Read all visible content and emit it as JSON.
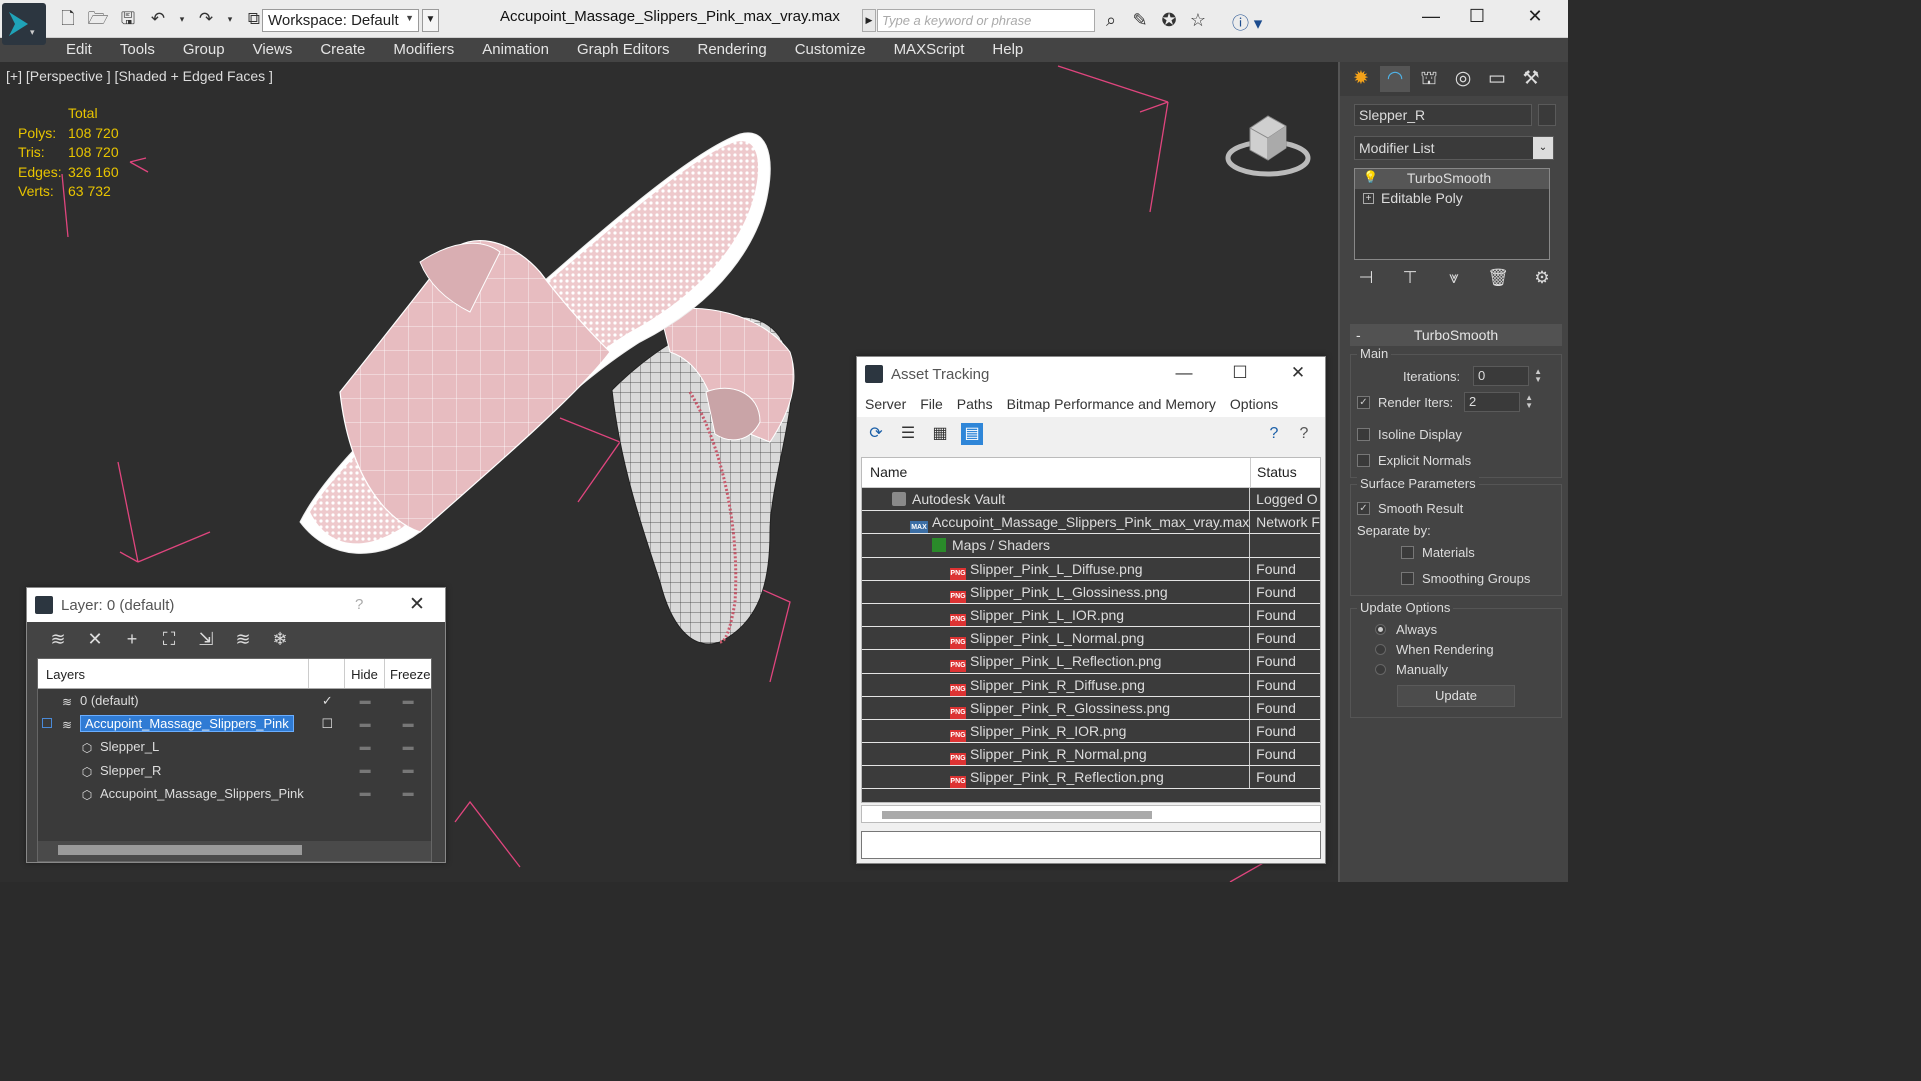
{
  "titlebar": {
    "workspace": "Workspace: Default",
    "document": "Accupoint_Massage_Slippers_Pink_max_vray.max",
    "search_placeholder": "Type a keyword or phrase"
  },
  "menu": [
    "Edit",
    "Tools",
    "Group",
    "Views",
    "Create",
    "Modifiers",
    "Animation",
    "Graph Editors",
    "Rendering",
    "Customize",
    "MAXScript",
    "Help"
  ],
  "viewport": {
    "label": "[+] [Perspective ] [Shaded + Edged Faces ]",
    "stats_header": "Total",
    "stats": [
      {
        "k": "Polys:",
        "v": "108 720"
      },
      {
        "k": "Tris:",
        "v": "108 720"
      },
      {
        "k": "Edges:",
        "v": "326 160"
      },
      {
        "k": "Verts:",
        "v": "63 732"
      }
    ],
    "colors": {
      "slipper": "#e8c3c6",
      "grid": "#e0457e",
      "stats": "#e8c400"
    }
  },
  "command_panel": {
    "object_name": "Slepper_R",
    "modifier_list": "Modifier List",
    "stack": [
      "TurboSmooth",
      "Editable Poly"
    ],
    "rollout_title": "TurboSmooth",
    "main_label": "Main",
    "iterations_label": "Iterations:",
    "iterations_value": "0",
    "render_iters_label": "Render Iters:",
    "render_iters_value": "2",
    "isoline": "Isoline Display",
    "explicit_normals": "Explicit Normals",
    "surface_params": "Surface Parameters",
    "smooth_result": "Smooth Result",
    "separate_by": "Separate by:",
    "materials": "Materials",
    "smoothing_groups": "Smoothing Groups",
    "update_options": "Update Options",
    "always": "Always",
    "when_rendering": "When Rendering",
    "manually": "Manually",
    "update_button": "Update"
  },
  "asset_tracking": {
    "title": "Asset Tracking",
    "menu": [
      "Server",
      "File",
      "Paths",
      "Bitmap Performance and Memory",
      "Options"
    ],
    "col_name": "Name",
    "col_status": "Status",
    "rows": [
      {
        "name": "Autodesk Vault",
        "status": "Logged O",
        "indent": 30,
        "icon": "vault"
      },
      {
        "name": "Accupoint_Massage_Slippers_Pink_max_vray.max",
        "status": "Network F",
        "indent": 48,
        "icon": "max"
      },
      {
        "name": "Maps / Shaders",
        "status": "",
        "indent": 70,
        "icon": "maps"
      },
      {
        "name": "Slipper_Pink_L_Diffuse.png",
        "status": "Found",
        "indent": 88,
        "icon": "png"
      },
      {
        "name": "Slipper_Pink_L_Glossiness.png",
        "status": "Found",
        "indent": 88,
        "icon": "png"
      },
      {
        "name": "Slipper_Pink_L_IOR.png",
        "status": "Found",
        "indent": 88,
        "icon": "png"
      },
      {
        "name": "Slipper_Pink_L_Normal.png",
        "status": "Found",
        "indent": 88,
        "icon": "png"
      },
      {
        "name": "Slipper_Pink_L_Reflection.png",
        "status": "Found",
        "indent": 88,
        "icon": "png"
      },
      {
        "name": "Slipper_Pink_R_Diffuse.png",
        "status": "Found",
        "indent": 88,
        "icon": "png"
      },
      {
        "name": "Slipper_Pink_R_Glossiness.png",
        "status": "Found",
        "indent": 88,
        "icon": "png"
      },
      {
        "name": "Slipper_Pink_R_IOR.png",
        "status": "Found",
        "indent": 88,
        "icon": "png"
      },
      {
        "name": "Slipper_Pink_R_Normal.png",
        "status": "Found",
        "indent": 88,
        "icon": "png"
      },
      {
        "name": "Slipper_Pink_R_Reflection.png",
        "status": "Found",
        "indent": 88,
        "icon": "png"
      }
    ],
    "png_badge": "PNG",
    "max_badge": "MAX"
  },
  "layer_window": {
    "title": "Layer: 0 (default)",
    "help": "?",
    "col_layers": "Layers",
    "col_hide": "Hide",
    "col_freeze": "Freeze",
    "rows": [
      {
        "name": "0 (default)",
        "indent": 22
      },
      {
        "name": "Accupoint_Massage_Slippers_Pink",
        "indent": 22
      },
      {
        "name": "Slepper_L",
        "indent": 42
      },
      {
        "name": "Slepper_R",
        "indent": 42
      },
      {
        "name": "Accupoint_Massage_Slippers_Pink",
        "indent": 42
      }
    ]
  }
}
